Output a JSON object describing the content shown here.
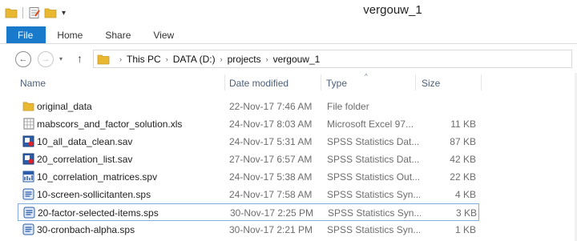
{
  "window": {
    "title": "vergouw_1"
  },
  "quick_access": {
    "items": [
      "folder-icon",
      "properties-icon",
      "new-folder-icon"
    ],
    "dropdown": "▾"
  },
  "ribbon": {
    "tabs": [
      "File",
      "Home",
      "Share",
      "View"
    ]
  },
  "nav": {
    "back": "←",
    "forward": "→",
    "recent": "▾",
    "up": "↑",
    "breadcrumbs": [
      "This PC",
      "DATA (D:)",
      "projects",
      "vergouw_1"
    ]
  },
  "columns": {
    "name": "Name",
    "date": "Date modified",
    "type": "Type",
    "size": "Size",
    "sort_indicator": "^"
  },
  "files": [
    {
      "name": "original_data",
      "date": "22-Nov-17 7:46 AM",
      "type": "File folder",
      "size": "",
      "icon": "folder-icon"
    },
    {
      "name": "mabscors_and_factor_solution.xls",
      "date": "24-Nov-17 8:03 AM",
      "type": "Microsoft Excel 97...",
      "size": "11 KB",
      "icon": "excel-file-icon"
    },
    {
      "name": "10_all_data_clean.sav",
      "date": "24-Nov-17 5:31 AM",
      "type": "SPSS Statistics Dat...",
      "size": "87 KB",
      "icon": "spss-data-icon"
    },
    {
      "name": "20_correlation_list.sav",
      "date": "27-Nov-17 6:57 AM",
      "type": "SPSS Statistics Dat...",
      "size": "42 KB",
      "icon": "spss-data-icon"
    },
    {
      "name": "10_correlation_matrices.spv",
      "date": "24-Nov-17 5:38 AM",
      "type": "SPSS Statistics Out...",
      "size": "22 KB",
      "icon": "spss-output-icon"
    },
    {
      "name": "10-screen-sollicitanten.sps",
      "date": "24-Nov-17 7:58 AM",
      "type": "SPSS Statistics Syn...",
      "size": "4 KB",
      "icon": "spss-syntax-icon"
    },
    {
      "name": "20-factor-selected-items.sps",
      "date": "30-Nov-17 2:25 PM",
      "type": "SPSS Statistics Syn...",
      "size": "3 KB",
      "icon": "spss-syntax-icon",
      "selected": true
    },
    {
      "name": "30-cronbach-alpha.sps",
      "date": "30-Nov-17 2:21 PM",
      "type": "SPSS Statistics Syn...",
      "size": "1 KB",
      "icon": "spss-syntax-icon"
    }
  ],
  "colors": {
    "accent": "#1979ca",
    "selection_border": "#84acdd",
    "folder": "#e8b830",
    "header_text": "#4c607a"
  }
}
